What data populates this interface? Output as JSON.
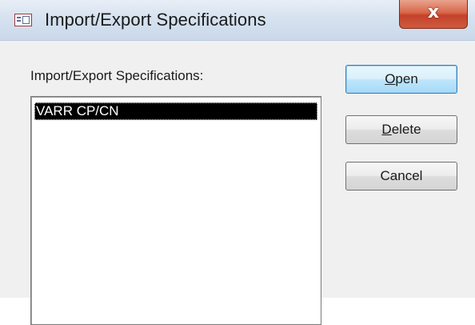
{
  "window": {
    "title": "Import/Export Specifications",
    "close_label": "x"
  },
  "dialog": {
    "list_label": "Import/Export Specifications:",
    "specifications": [
      {
        "name": "VARR CP/CN",
        "selected": true
      }
    ]
  },
  "buttons": {
    "open": {
      "label_access_key": "O",
      "label_rest": "pen"
    },
    "delete": {
      "label_access_key": "D",
      "label_rest": "elete"
    },
    "cancel": {
      "label": "Cancel"
    }
  },
  "icons": {
    "app": "access-form-icon",
    "close": "close-icon"
  },
  "colors": {
    "selection_background": "#000000",
    "selection_text": "#ffffff",
    "close_button": "#c3412a",
    "default_button_border": "#3c7fb1"
  }
}
